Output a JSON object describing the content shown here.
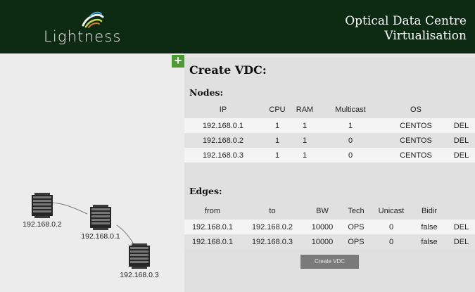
{
  "header": {
    "logo_text": "Lightness",
    "title_line1": "Optical Data Centre",
    "title_line2": "Virtualisation"
  },
  "topology": {
    "nodes": [
      {
        "label": "192.168.0.2"
      },
      {
        "label": "192.168.0.1"
      },
      {
        "label": "192.168.0.3"
      }
    ],
    "add_label": "+"
  },
  "panel": {
    "title": "Create VDC:",
    "nodes_heading": "Nodes:",
    "node_columns": [
      "IP",
      "CPU",
      "RAM",
      "Multicast",
      "OS",
      ""
    ],
    "node_rows": [
      [
        "192.168.0.1",
        "1",
        "1",
        "1",
        "CENTOS",
        "DEL"
      ],
      [
        "192.168.0.2",
        "1",
        "1",
        "0",
        "CENTOS",
        "DEL"
      ],
      [
        "192.168.0.3",
        "1",
        "1",
        "0",
        "CENTOS",
        "DEL"
      ]
    ],
    "edges_heading": "Edges:",
    "edge_columns": [
      "from",
      "to",
      "BW",
      "Tech",
      "Unicast",
      "Bidir",
      ""
    ],
    "edge_rows": [
      [
        "192.168.0.1",
        "192.168.0.2",
        "10000",
        "OPS",
        "0",
        "false",
        "DEL"
      ],
      [
        "192.168.0.1",
        "192.168.0.3",
        "10000",
        "OPS",
        "0",
        "false",
        "DEL"
      ]
    ],
    "create_button": "Create VDC"
  },
  "colors": {
    "header_bg": "#0d2a13",
    "add_button": "#4b9a32",
    "create_button": "#7a7a7a"
  }
}
